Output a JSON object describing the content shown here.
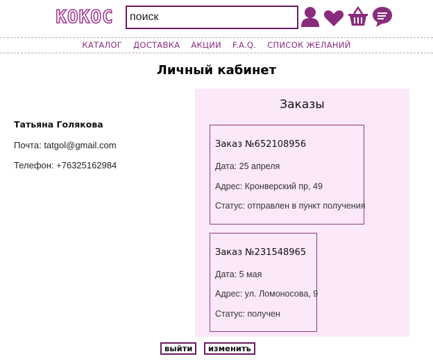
{
  "header": {
    "logo_text": "КОКОС",
    "search_placeholder": "поиск",
    "icons": [
      "user-icon",
      "heart-icon",
      "basket-icon",
      "chat-icon"
    ]
  },
  "nav": [
    "КАТАЛОГ",
    "ДОСТАВКА",
    "АКЦИИ",
    "F.A.Q.",
    "СПИСОК ЖЕЛАНИЙ"
  ],
  "page_title": "Личный кабинет",
  "user": {
    "name": "Татьяна Голякова",
    "email": "Почта: tatgol@gmail.com",
    "phone": "Телефон: +76325162984"
  },
  "orders": {
    "title": "Заказы",
    "items": [
      {
        "number": "Заказ №652108956",
        "date": "Дата: 25 апреля",
        "address": "Адрес: Кронверский пр, 49",
        "status": "Статус: отправлен в пункт получения"
      },
      {
        "number": "Заказ №231548965",
        "date": "Дата: 5 мая",
        "address": "Адрес: ул. Ломоносова, 9",
        "status": "Статус: получен"
      }
    ]
  },
  "buttons": {
    "logout": "выйти",
    "edit": "изменить"
  },
  "colors": {
    "accent": "#8a2c7e",
    "dark_accent": "#6a1a5e",
    "panel_bg": "#fbe8f8"
  }
}
